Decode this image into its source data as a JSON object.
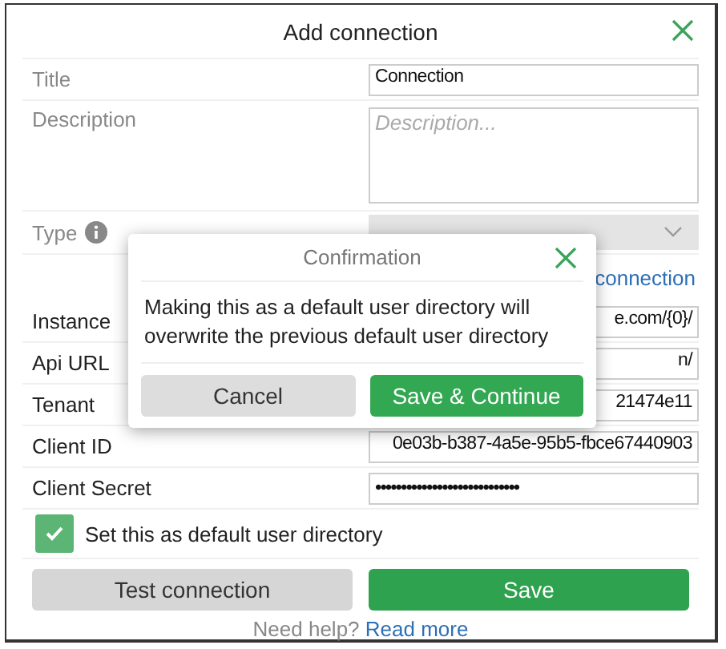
{
  "dialog": {
    "title": "Add connection",
    "rows": [
      {
        "kind": "input",
        "label": "Title",
        "value": "Connection",
        "disabled": true
      },
      {
        "kind": "textarea",
        "label": "Description",
        "placeholder": "Description...",
        "disabled": true
      },
      {
        "kind": "select",
        "label": "Type",
        "disabled": true
      },
      {
        "kind": "link",
        "text": "connection"
      },
      {
        "kind": "input",
        "label": "Instance",
        "value": "e.com/{0}/",
        "disabled": false
      },
      {
        "kind": "input",
        "label": "Api URL",
        "value": "n/",
        "disabled": false
      },
      {
        "kind": "input",
        "label": "Tenant",
        "value": "21474e11",
        "disabled": false
      },
      {
        "kind": "input",
        "label": "Client ID",
        "value": "0e03b-b387-4a5e-95b5-fbce67440903",
        "disabled": false
      },
      {
        "kind": "password",
        "label": "Client Secret",
        "value": "••••••••••••••••••••••••••••",
        "disabled": false
      }
    ],
    "checkbox": {
      "label": "Set this as default user directory",
      "checked": true
    },
    "buttons": [
      {
        "label": "Test connection",
        "kind": "secondary"
      },
      {
        "label": "Save",
        "kind": "primary"
      }
    ],
    "help": {
      "text": "Need help?",
      "link": "Read more"
    }
  },
  "confirmation": {
    "title": "Confirmation",
    "message": "Making this as a default user directory will overwrite the previous default user directory",
    "buttons": [
      {
        "label": "Cancel",
        "kind": "secondary"
      },
      {
        "label": "Save & Continue",
        "kind": "primary"
      }
    ]
  }
}
